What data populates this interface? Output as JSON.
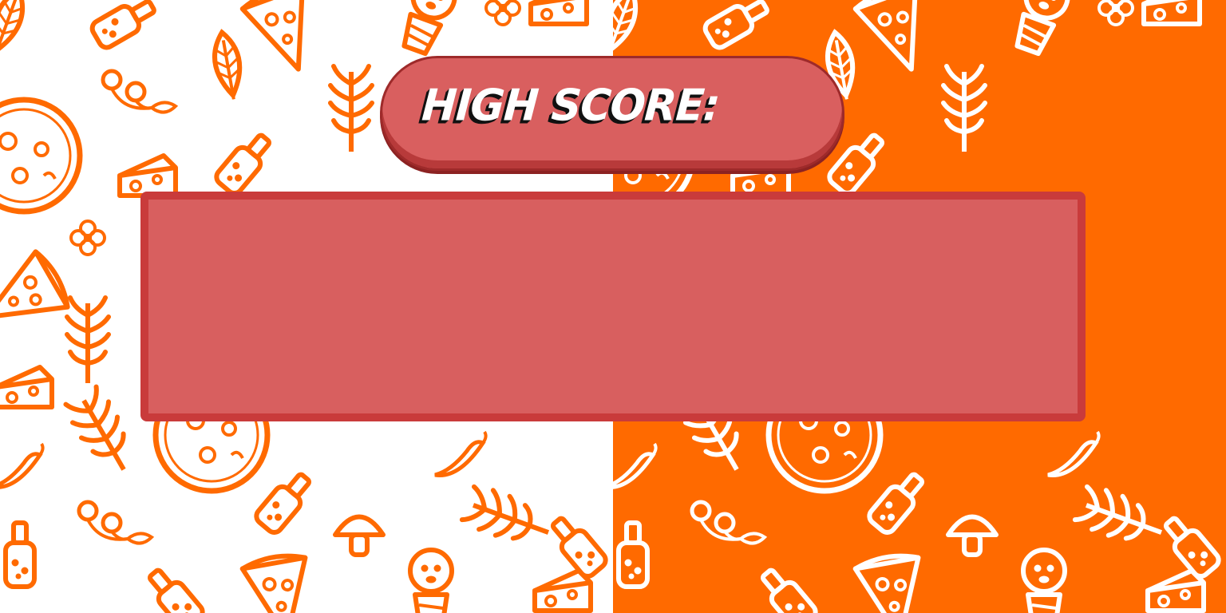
{
  "background": {
    "left_color": "#ffffff",
    "left_doodle_color": "#ff6a00",
    "right_color": "#ff6a00",
    "right_doodle_color": "#ffffff",
    "motif": "pizza-doodles"
  },
  "high_score": {
    "label": "HIGH SCORE:",
    "value": "",
    "pill_color": "#d95f5f",
    "pill_border_color": "#9e2a2a"
  },
  "score_panel": {
    "fill_color": "#d85f5f",
    "border_color": "#c93b3b",
    "content": ""
  }
}
